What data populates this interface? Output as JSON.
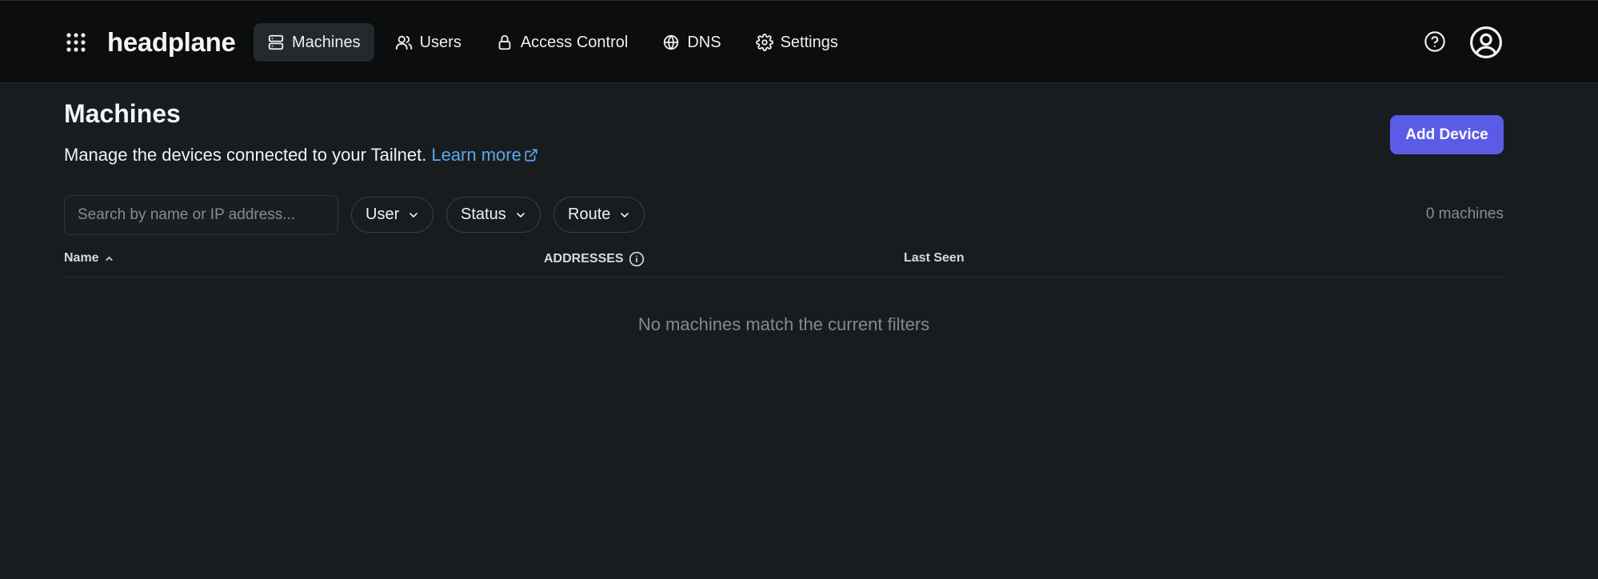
{
  "brand": {
    "name": "headplane"
  },
  "nav": {
    "items": [
      {
        "id": "machines",
        "label": "Machines",
        "active": true,
        "icon": "server-icon"
      },
      {
        "id": "users",
        "label": "Users",
        "active": false,
        "icon": "users-icon"
      },
      {
        "id": "access-control",
        "label": "Access Control",
        "active": false,
        "icon": "lock-icon"
      },
      {
        "id": "dns",
        "label": "DNS",
        "active": false,
        "icon": "globe-icon"
      },
      {
        "id": "settings",
        "label": "Settings",
        "active": false,
        "icon": "gear-icon"
      }
    ]
  },
  "header_actions": {
    "help_icon": "help-circle-icon",
    "account_icon": "user-circle-icon"
  },
  "page": {
    "title": "Machines",
    "subtitle": "Manage the devices connected to your Tailnet.",
    "learn_more": "Learn more",
    "add_button": "Add Device"
  },
  "filters": {
    "search_placeholder": "Search by name or IP address...",
    "search_value": "",
    "user": "User",
    "status": "Status",
    "route": "Route",
    "count": "0 machines"
  },
  "table": {
    "columns": {
      "name": "Name",
      "addresses": "ADDRESSES",
      "last_seen": "Last Seen"
    },
    "sort": {
      "column": "name",
      "direction": "ascending"
    },
    "rows": [],
    "empty_message": "No machines match the current filters"
  },
  "colors": {
    "background": "#191c1f",
    "topbar": "#0b0d0f",
    "accent": "#5b5ce6",
    "link": "#5aa7f0",
    "muted_text": "#858c91"
  }
}
